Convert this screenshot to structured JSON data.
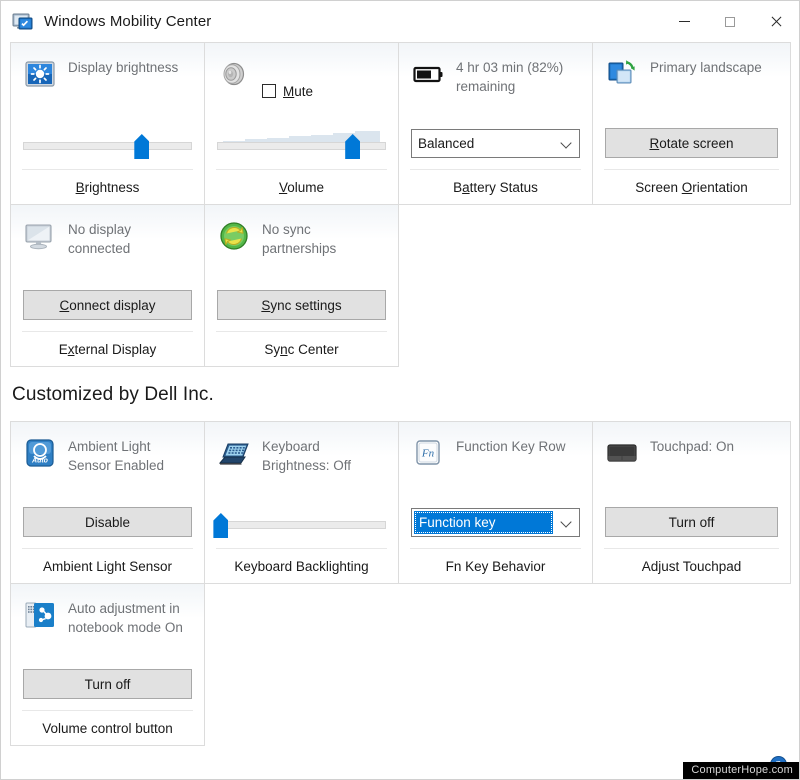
{
  "window": {
    "title": "Windows Mobility Center",
    "icon": "mobility-center-icon",
    "buttons": {
      "minimize": "minimize-icon",
      "maximize": "maximize-icon",
      "close": "close-icon"
    }
  },
  "section_title": "Customized by Dell Inc.",
  "help": {
    "label": "?",
    "name": "help-button"
  },
  "watermark": "ComputerHope.com",
  "colors": {
    "accent": "#0078d7",
    "tile_border": "#dcdcdc",
    "button_face": "#e1e1e1",
    "label_gray": "#6f7276",
    "watermark_bg": "#000000"
  },
  "tiles": [
    {
      "name": "display-brightness",
      "icon": "brightness-icon",
      "status": "Display brightness",
      "control": "slider",
      "slider": {
        "value": 70,
        "wedge": false
      },
      "footer": "Brightness",
      "footer_accel": "B"
    },
    {
      "name": "volume",
      "icon": "speaker-icon",
      "status": "Mute",
      "status_accel": "M",
      "control": "checkbox-slider",
      "checkbox": {
        "label": "Mute",
        "checked": false
      },
      "slider": {
        "value": 80,
        "wedge": true
      },
      "footer": "Volume",
      "footer_accel": "V"
    },
    {
      "name": "battery-status",
      "icon": "battery-icon",
      "status": "4 hr 03 min (82%) remaining",
      "control": "combo",
      "combo": {
        "value": "Balanced",
        "focused": false
      },
      "footer": "Battery Status",
      "footer_accel": "a"
    },
    {
      "name": "screen-orientation",
      "icon": "screen-rotate-icon",
      "status": "Primary landscape",
      "control": "button",
      "button": {
        "label": "Rotate screen",
        "accel": "R"
      },
      "footer": "Screen Orientation",
      "footer_accel": "O"
    },
    {
      "name": "external-display",
      "icon": "monitor-icon",
      "status": "No display connected",
      "control": "button",
      "button": {
        "label": "Connect display",
        "accel": "C"
      },
      "footer": "External Display",
      "footer_accel": "x"
    },
    {
      "name": "sync-center",
      "icon": "sync-icon",
      "status": "No sync partnerships",
      "control": "button",
      "button": {
        "label": "Sync settings",
        "accel": "S"
      },
      "footer": "Sync Center",
      "footer_accel": "n"
    }
  ],
  "dell_tiles": [
    {
      "name": "ambient-light-sensor",
      "icon": "ambient-light-sensor-icon",
      "status": "Ambient Light Sensor Enabled",
      "control": "button",
      "button": {
        "label": "Disable"
      },
      "footer": "Ambient Light Sensor"
    },
    {
      "name": "keyboard-backlighting",
      "icon": "keyboard-backlight-icon",
      "status": "Keyboard Brightness: Off",
      "control": "slider",
      "slider": {
        "value": 2,
        "wedge": false
      },
      "footer": "Keyboard Backlighting"
    },
    {
      "name": "fn-key-behavior",
      "icon": "fn-key-icon",
      "status": "Function Key Row",
      "control": "combo",
      "combo": {
        "value": "Function key",
        "focused": true
      },
      "footer": "Fn Key Behavior"
    },
    {
      "name": "adjust-touchpad",
      "icon": "touchpad-icon",
      "status": "Touchpad: On",
      "control": "button",
      "button": {
        "label": "Turn off"
      },
      "footer": "Adjust Touchpad"
    },
    {
      "name": "volume-control-button",
      "icon": "volume-auto-icon",
      "status": "Auto adjustment in notebook mode On",
      "control": "button",
      "button": {
        "label": "Turn off"
      },
      "footer": "Volume control button"
    }
  ]
}
